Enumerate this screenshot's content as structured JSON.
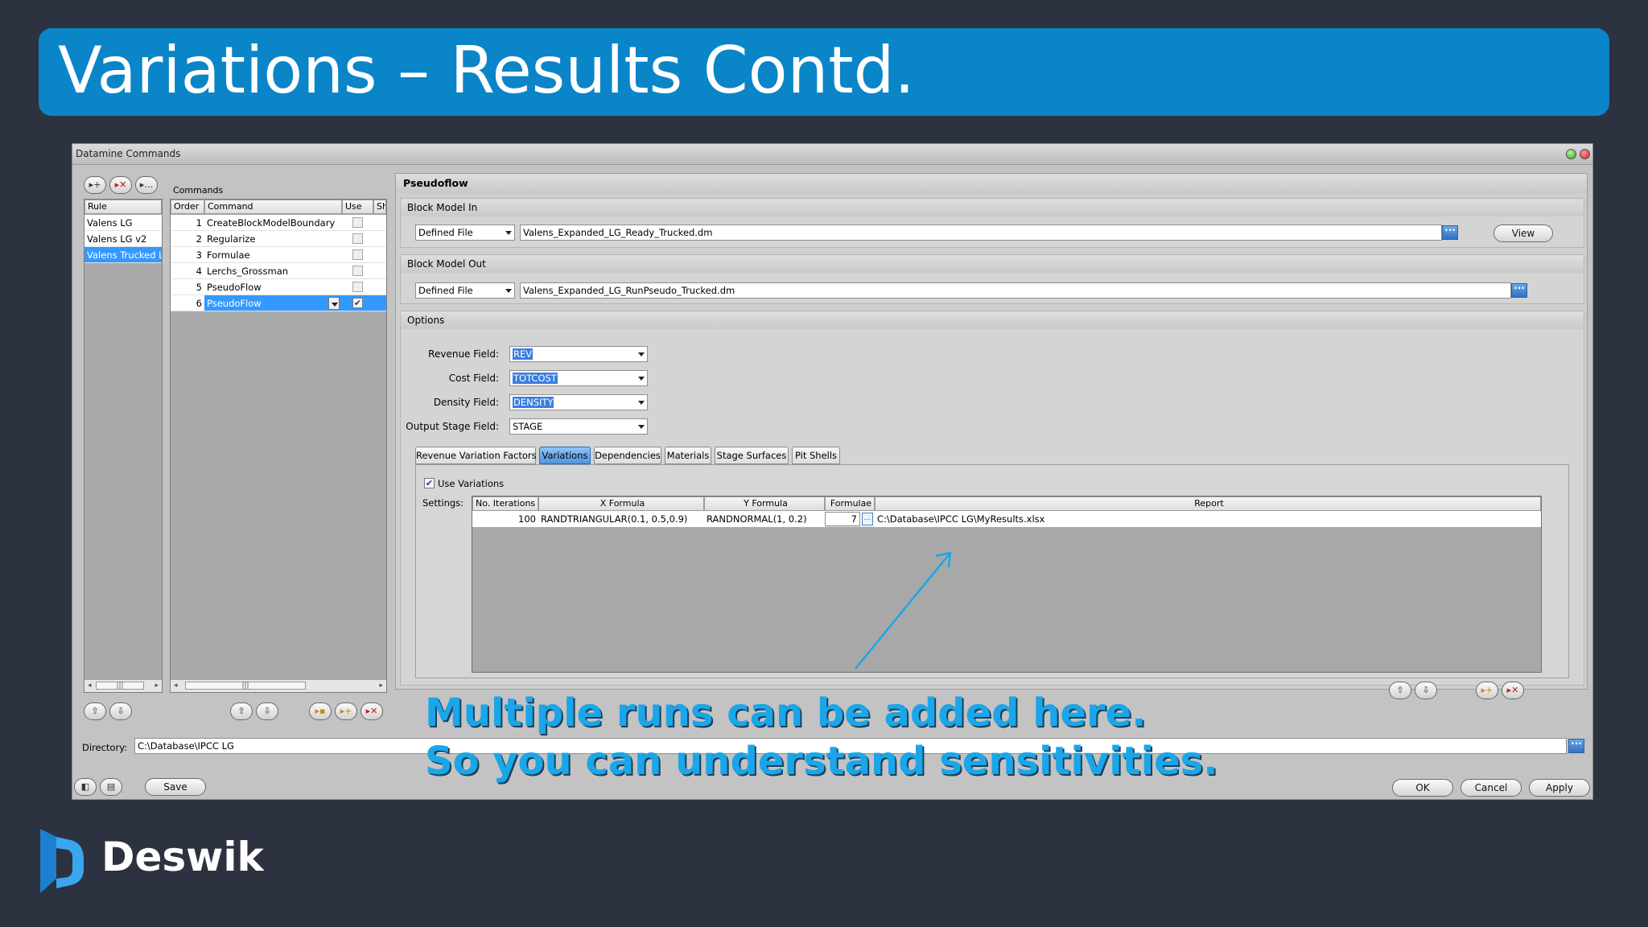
{
  "slide": {
    "title": "Variations – Results Contd.",
    "overlay_line1": "Multiple runs can be added here.",
    "overlay_line2": "So you can understand sensitivities.",
    "logo_text": "Deswik",
    "logo_reg": "®",
    "accent_color": "#0a85c8",
    "overlay_color": "#1aa6e8"
  },
  "window": {
    "title": "Datamine Commands"
  },
  "rules": {
    "header": "Rule",
    "items": [
      "Valens LG",
      "Valens LG v2",
      "Valens Trucked L"
    ],
    "selected_index": 2
  },
  "commands": {
    "label": "Commands",
    "headers": {
      "order": "Order",
      "command": "Command",
      "use": "Use",
      "sh": "Sh"
    },
    "rows": [
      {
        "order": "1",
        "command": "CreateBlockModelBoundary",
        "use": false
      },
      {
        "order": "2",
        "command": "Regularize",
        "use": false
      },
      {
        "order": "3",
        "command": "Formulae",
        "use": false
      },
      {
        "order": "4",
        "command": "Lerchs_Grossman",
        "use": false
      },
      {
        "order": "5",
        "command": "PseudoFlow",
        "use": false
      },
      {
        "order": "6",
        "command": "PseudoFlow",
        "use": true
      }
    ],
    "selected_index": 5
  },
  "pseudoflow": {
    "title": "Pseudoflow",
    "block_model_in": {
      "label": "Block Model In",
      "type": "Defined File",
      "file": "Valens_Expanded_LG_Ready_Trucked.dm",
      "view_label": "View"
    },
    "block_model_out": {
      "label": "Block Model Out",
      "type": "Defined File",
      "file": "Valens_Expanded_LG_RunPseudo_Trucked.dm"
    },
    "options": {
      "label": "Options",
      "revenue_label": "Revenue Field:",
      "revenue_value": "REV",
      "cost_label": "Cost Field:",
      "cost_value": "TOTCOST",
      "density_label": "Density Field:",
      "density_value": "DENSITY",
      "stage_label": "Output Stage Field:",
      "stage_value": "STAGE"
    },
    "tabs": [
      "Revenue Variation Factors",
      "Variations",
      "Dependencies",
      "Materials",
      "Stage Surfaces",
      "Pit Shells"
    ],
    "active_tab": 1,
    "variations": {
      "use_label": "Use Variations",
      "use_checked": true,
      "settings_label": "Settings:",
      "headers": {
        "iterations": "No. Iterations",
        "x": "X Formula",
        "y": "Y Formula",
        "formulae": "Formulae",
        "report": "Report"
      },
      "row": {
        "iterations": "100",
        "x": "RANDTRIANGULAR(0.1, 0.5,0.9)",
        "y": "RANDNORMAL(1, 0.2)",
        "formulae": "7",
        "report": "C:\\Database\\IPCC LG\\MyResults.xlsx"
      }
    }
  },
  "footer": {
    "directory_label": "Directory:",
    "directory_value": "C:\\Database\\IPCC LG",
    "save_label": "Save",
    "ok_label": "OK",
    "cancel_label": "Cancel",
    "apply_label": "Apply"
  }
}
